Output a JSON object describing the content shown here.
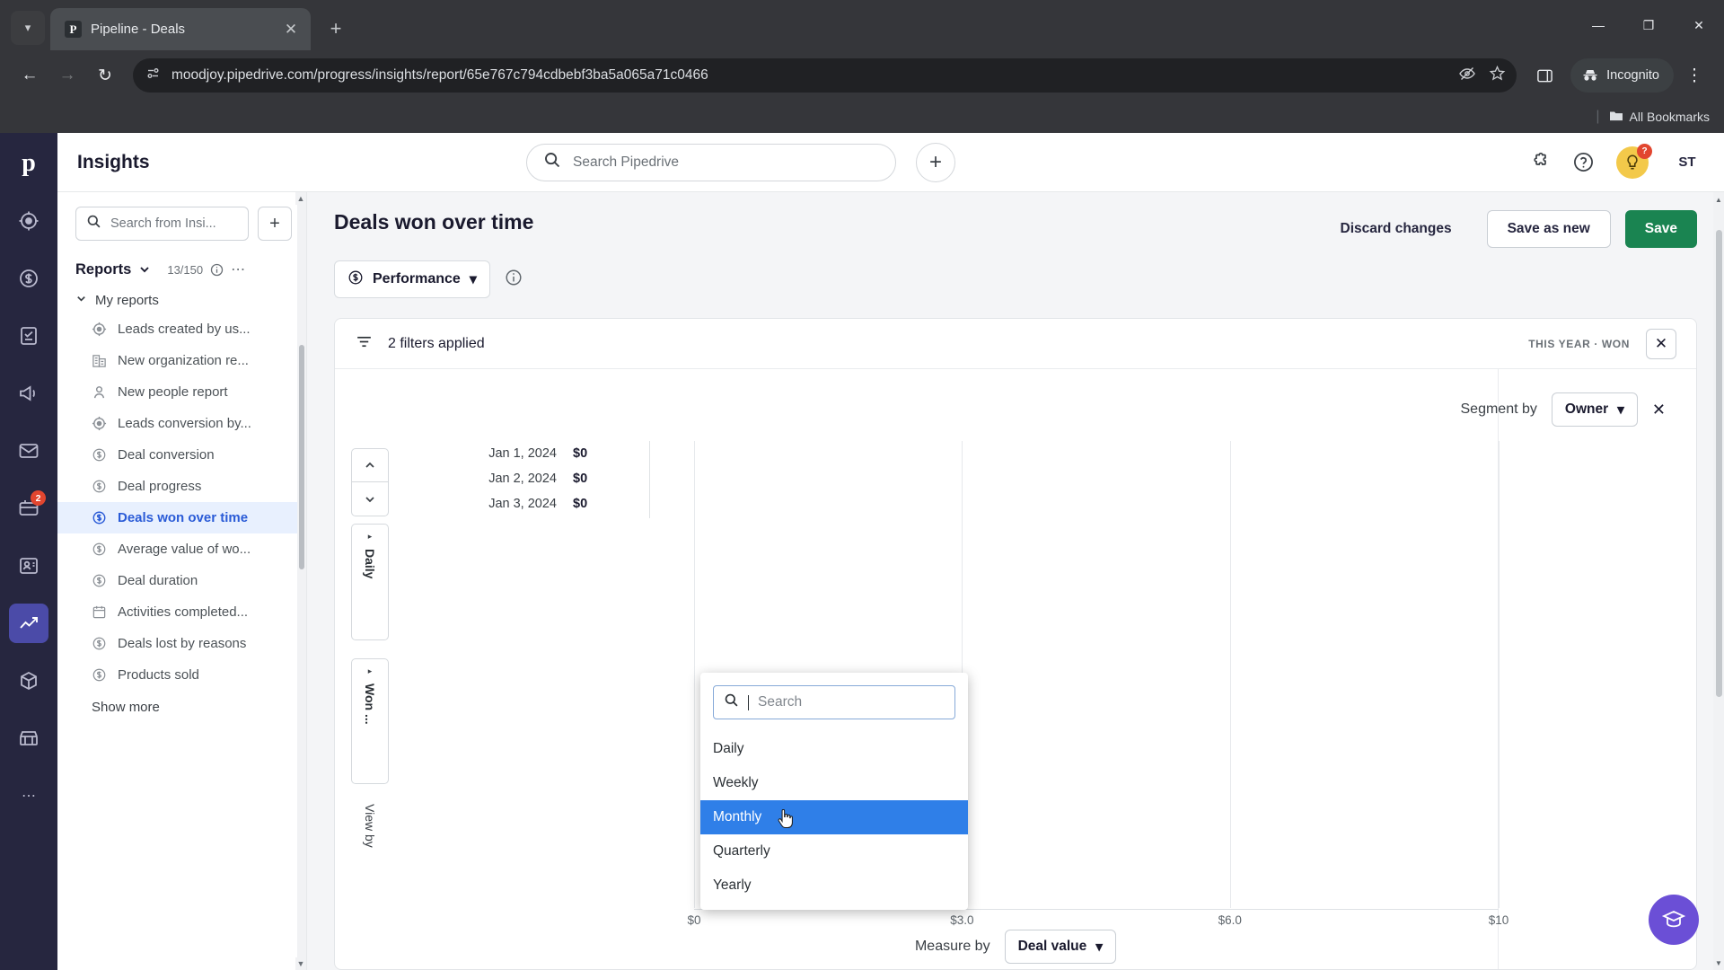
{
  "browser": {
    "tab": {
      "title": "Pipeline - Deals",
      "favicon_letter": "P"
    },
    "url": "moodjoy.pipedrive.com/progress/insights/report/65e767c794cdbebf3ba5a065a71c0466",
    "incognito_label": "Incognito",
    "bookmarks_label": "All Bookmarks",
    "window_minimize": "—",
    "window_maximize": "❐",
    "window_close": "✕",
    "newtab_label": "+",
    "tab_close": "✕",
    "back": "←",
    "forward": "→",
    "reload": "↻"
  },
  "app": {
    "logo_letter": "p",
    "header": {
      "title": "Insights",
      "search_placeholder": "Search Pipedrive",
      "add_label": "+",
      "avatar_initials": "ST",
      "bulb_badge": "?"
    },
    "rail": {
      "mail_badge": "2"
    }
  },
  "sidebar": {
    "search_placeholder": "Search from Insi...",
    "add_label": "+",
    "reports_label": "Reports",
    "count": "13/150",
    "group_label": "My reports",
    "show_more": "Show more",
    "items": [
      {
        "label": "Leads created by us...",
        "icon": "target-icon"
      },
      {
        "label": "New organization re...",
        "icon": "building-icon"
      },
      {
        "label": "New people report",
        "icon": "person-icon"
      },
      {
        "label": "Leads conversion by...",
        "icon": "target-icon"
      },
      {
        "label": "Deal conversion",
        "icon": "dollar-icon"
      },
      {
        "label": "Deal progress",
        "icon": "dollar-icon"
      },
      {
        "label": "Deals won over time",
        "icon": "dollar-icon",
        "selected": true
      },
      {
        "label": "Average value of wo...",
        "icon": "dollar-icon"
      },
      {
        "label": "Deal duration",
        "icon": "dollar-icon"
      },
      {
        "label": "Activities completed...",
        "icon": "calendar-icon"
      },
      {
        "label": "Deals lost by reasons",
        "icon": "dollar-icon"
      },
      {
        "label": "Products sold",
        "icon": "dollar-icon"
      }
    ]
  },
  "report": {
    "title": "Deals won over time",
    "discard_label": "Discard changes",
    "save_as_new_label": "Save as new",
    "save_label": "Save",
    "type_selector": "Performance",
    "filters_text": "2 filters applied",
    "filters_meta": "THIS YEAR · WON",
    "segment_label": "Segment by",
    "segment_value": "Owner",
    "measure_label": "Measure by",
    "measure_value": "Deal value",
    "interval_tab": "Daily",
    "won_tab": "Won ...",
    "viewby_tab": "View by"
  },
  "dropdown": {
    "search_placeholder": "Search",
    "options": [
      {
        "label": "Daily"
      },
      {
        "label": "Weekly"
      },
      {
        "label": "Monthly",
        "highlighted": true
      },
      {
        "label": "Quarterly"
      },
      {
        "label": "Yearly"
      }
    ]
  },
  "chart_data": {
    "type": "bar",
    "title": "Deals won over time",
    "xlabel": "Deal value",
    "ylabel": "",
    "categories": [
      "Jan 1, 2024",
      "Jan 2, 2024",
      "Jan 3, 2024"
    ],
    "values": [
      0,
      0,
      0
    ],
    "value_labels": [
      "$0",
      "$0",
      "$0"
    ],
    "xticks": [
      "$0",
      "$3.0",
      "$6.0",
      "$10"
    ],
    "xtick_positions": [
      0,
      33.3,
      66.6,
      100
    ],
    "grid": true,
    "legend": "none",
    "series": [
      {
        "name": "Deal value",
        "values": [
          0,
          0,
          0
        ]
      }
    ]
  }
}
